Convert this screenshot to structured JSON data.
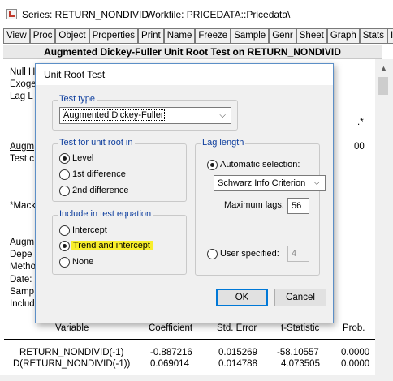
{
  "window": {
    "series_label": "Series: RETURN_NONDIVID",
    "workfile_label": "Workfile: PRICEDATA::Pricedata\\"
  },
  "toolbar": [
    "View",
    "Proc",
    "Object",
    "Properties",
    "Print",
    "Name",
    "Freeze",
    "Sample",
    "Genr",
    "Sheet",
    "Graph",
    "Stats",
    "I"
  ],
  "output": {
    "header": "Augmented Dickey-Fuller Unit Root Test on RETURN_NONDIVID",
    "left_lines": [
      "Null H",
      "Exoge",
      "Lag L",
      "Augm",
      "Test c",
      "*Mack",
      "Augm",
      "Depe",
      "Metho",
      "Date:",
      "Samp",
      "Includ"
    ],
    "right_fragments": [
      ".*",
      "00"
    ],
    "columns": [
      "Variable",
      "Coefficient",
      "Std. Error",
      "t-Statistic",
      "Prob."
    ],
    "row1": [
      "RETURN_NONDIVID(-1)",
      "-0.887216",
      "0.015269",
      "-58.10557",
      "0.0000"
    ],
    "row2_partial": [
      "D(RETURN_NONDIVID(-1))",
      "0.069014",
      "0.014788",
      "4.073505",
      "0.0000"
    ]
  },
  "dialog": {
    "title": "Unit Root Test",
    "test_type": {
      "title": "Test type",
      "value": "Augmented Dickey-Fuller"
    },
    "test_for": {
      "title": "Test for unit root in",
      "options": [
        "Level",
        "1st difference",
        "2nd difference"
      ],
      "selected": "Level"
    },
    "include": {
      "title": "Include in test equation",
      "options": [
        "Intercept",
        "Trend and intercept",
        "None"
      ],
      "selected": "Trend and intercept"
    },
    "lag": {
      "title": "Lag length",
      "auto_label": "Automatic selection:",
      "criterion": "Schwarz Info Criterion",
      "max_lags_label": "Maximum lags:",
      "max_lags_value": "56",
      "user_label": "User specified:",
      "user_value": "4",
      "selected": "auto"
    },
    "ok_label": "OK",
    "cancel_label": "Cancel"
  },
  "colors": {
    "group_title": "#0f3f9e",
    "highlight": "#f8ee2b",
    "default_button": "#0078d7"
  }
}
